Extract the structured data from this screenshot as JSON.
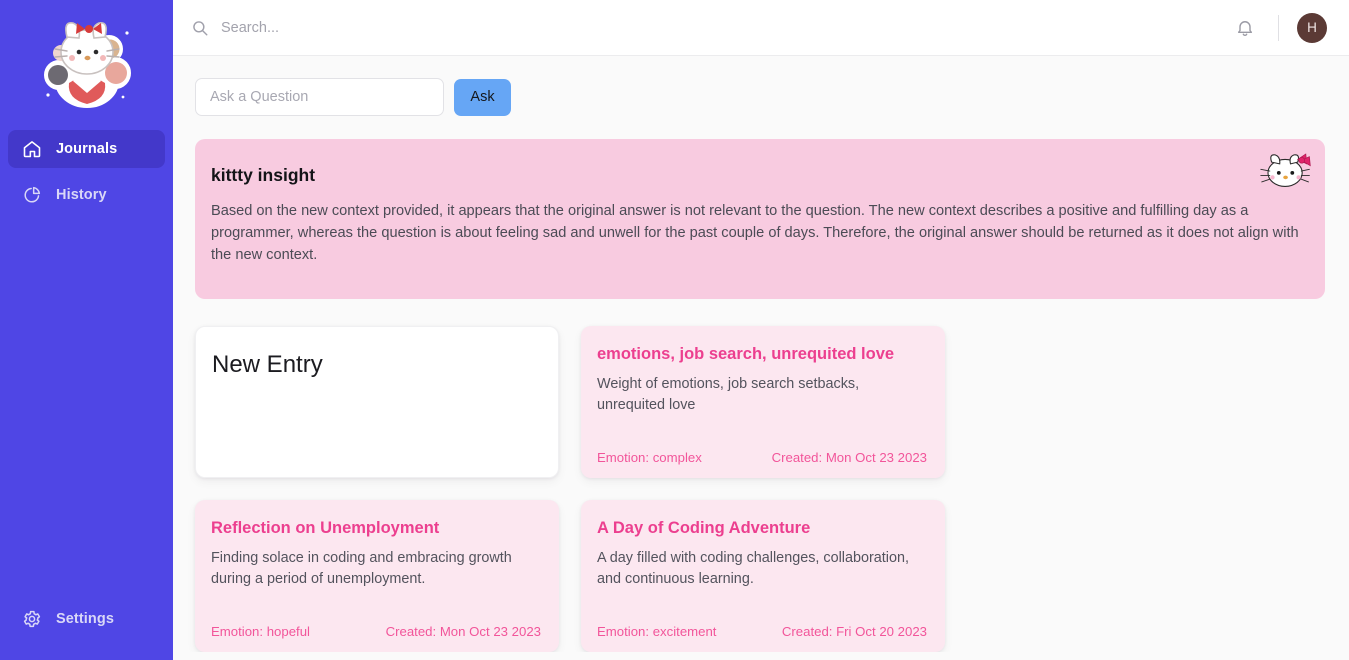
{
  "sidebar": {
    "logo_alt": "kitty-mascot-sticker",
    "items": [
      {
        "label": "Journals",
        "icon": "home-icon",
        "active": true
      },
      {
        "label": "History",
        "icon": "pie-chart-icon",
        "active": false
      }
    ],
    "bottom": {
      "label": "Settings",
      "icon": "gear-icon"
    }
  },
  "header": {
    "search": {
      "placeholder": "Search...",
      "value": ""
    },
    "notifications_icon": "bell-icon",
    "avatar_initial": "H"
  },
  "ask": {
    "placeholder": "Ask a Question",
    "value": "",
    "button_label": "Ask"
  },
  "insight": {
    "title": "kittty insight",
    "body": "Based on the new context provided, it appears that the original answer is not relevant to the question. The new context describes a positive and fulfilling day as a programmer, whereas the question is about feeling sad and unwell for the past couple of days. Therefore, the original answer should be returned as it does not align with the new context.",
    "icon": "hello-kitty-face-icon"
  },
  "entries": {
    "new_entry_label": "New Entry",
    "items": [
      {
        "title": "emotions, job search, unrequited love",
        "description": "Weight of emotions, job search setbacks, unrequited love",
        "emotion": "Emotion: complex",
        "created": "Created: Mon Oct 23 2023"
      },
      {
        "title": "Reflection on Unemployment",
        "description": "Finding solace in coding and embracing growth during a period of unemployment.",
        "emotion": "Emotion: hopeful",
        "created": "Created: Mon Oct 23 2023"
      },
      {
        "title": "A Day of Coding Adventure",
        "description": "A day filled with coding challenges, collaboration, and continuous learning.",
        "emotion": "Emotion: excitement",
        "created": "Created: Fri Oct 20 2023"
      }
    ]
  },
  "colors": {
    "sidebar": "#4f46e5",
    "sidebar_active": "#4338ca",
    "insight_bg": "#f8cbe0",
    "card_bg": "#fce7f0",
    "accent_pink": "#ec3f8f",
    "ask_button": "#66a6f5",
    "avatar": "#5b3a35"
  }
}
